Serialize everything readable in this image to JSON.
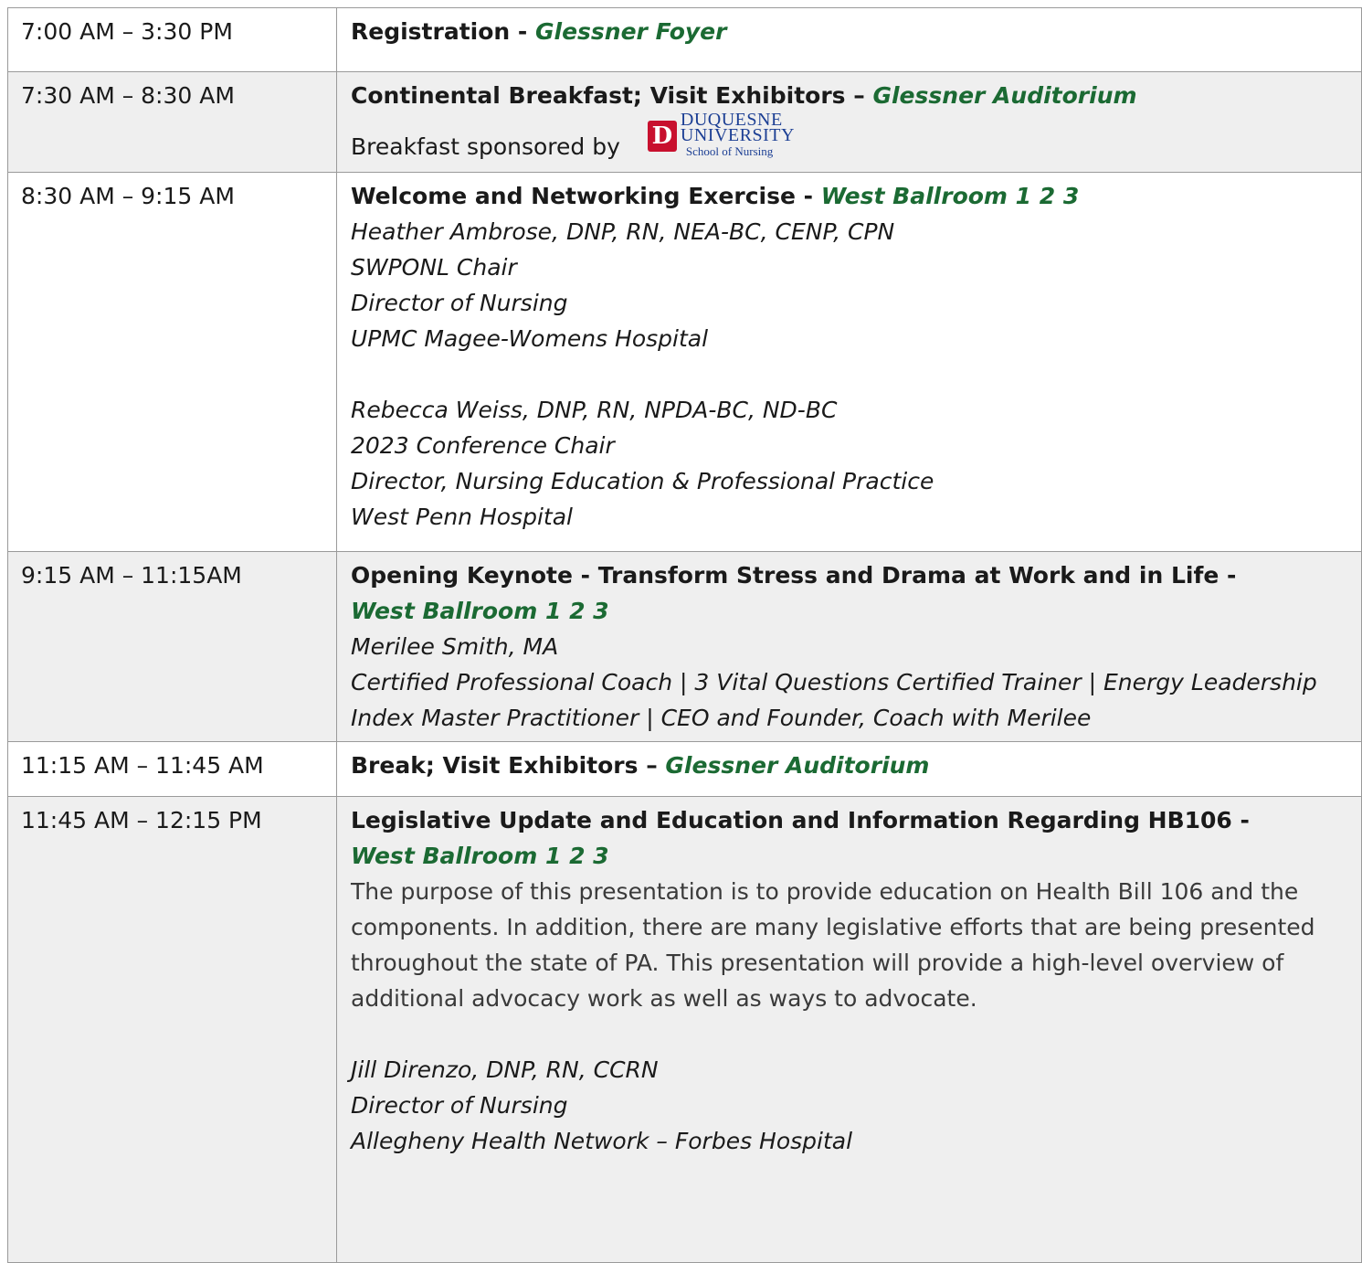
{
  "rows": [
    {
      "time": "7:00 AM – 3:30 PM",
      "title": "Registration - ",
      "location": "Glessner Foyer"
    },
    {
      "time": "7:30 AM – 8:30 AM",
      "title": "Continental Breakfast; Visit Exhibitors – ",
      "location": "Glessner Auditorium",
      "sponsor_text": "Breakfast sponsored by",
      "sponsor_logo": {
        "mark": "D",
        "line1": "DUQUESNE",
        "line2": "UNIVERSITY",
        "line3": "School of Nursing"
      }
    },
    {
      "time": "8:30 AM – 9:15 AM",
      "title": "Welcome and Networking Exercise - ",
      "location": "West Ballroom 1 2 3",
      "speakers": [
        [
          "Heather Ambrose, DNP, RN, NEA-BC, CENP, CPN",
          "SWPONL Chair",
          "Director of Nursing",
          "UPMC Magee-Womens Hospital"
        ],
        [
          "Rebecca Weiss, DNP, RN, NPDA-BC, ND-BC",
          "2023 Conference Chair",
          "Director, Nursing Education & Professional Practice",
          "West Penn Hospital"
        ]
      ]
    },
    {
      "time": "9:15 AM – 11:15AM",
      "title": "Opening Keynote - Transform Stress and Drama at Work and in Life -",
      "location": "West Ballroom 1 2 3",
      "speaker_lines": [
        "Merilee Smith, MA",
        "Certified Professional Coach | 3 Vital Questions Certified Trainer | Energy Leadership Index Master Practitioner | CEO and Founder, Coach with Merilee"
      ]
    },
    {
      "time": "11:15 AM – 11:45 AM",
      "title": "Break; Visit Exhibitors – ",
      "location": "Glessner Auditorium"
    },
    {
      "time": "11:45 AM – 12:15 PM",
      "title": "Legislative Update and Education and Information Regarding HB106 -",
      "location": "West Ballroom 1 2 3",
      "description": "The purpose of this presentation is to provide education on Health Bill 106 and the components. In addition, there are many legislative efforts that are being presented throughout the state of PA. This presentation will provide a high-level overview of additional advocacy work as well as ways to advocate.",
      "speaker_lines": [
        "Jill Direnzo, DNP, RN, CCRN",
        "Director of Nursing",
        "Allegheny Health Network – Forbes Hospital"
      ]
    }
  ]
}
